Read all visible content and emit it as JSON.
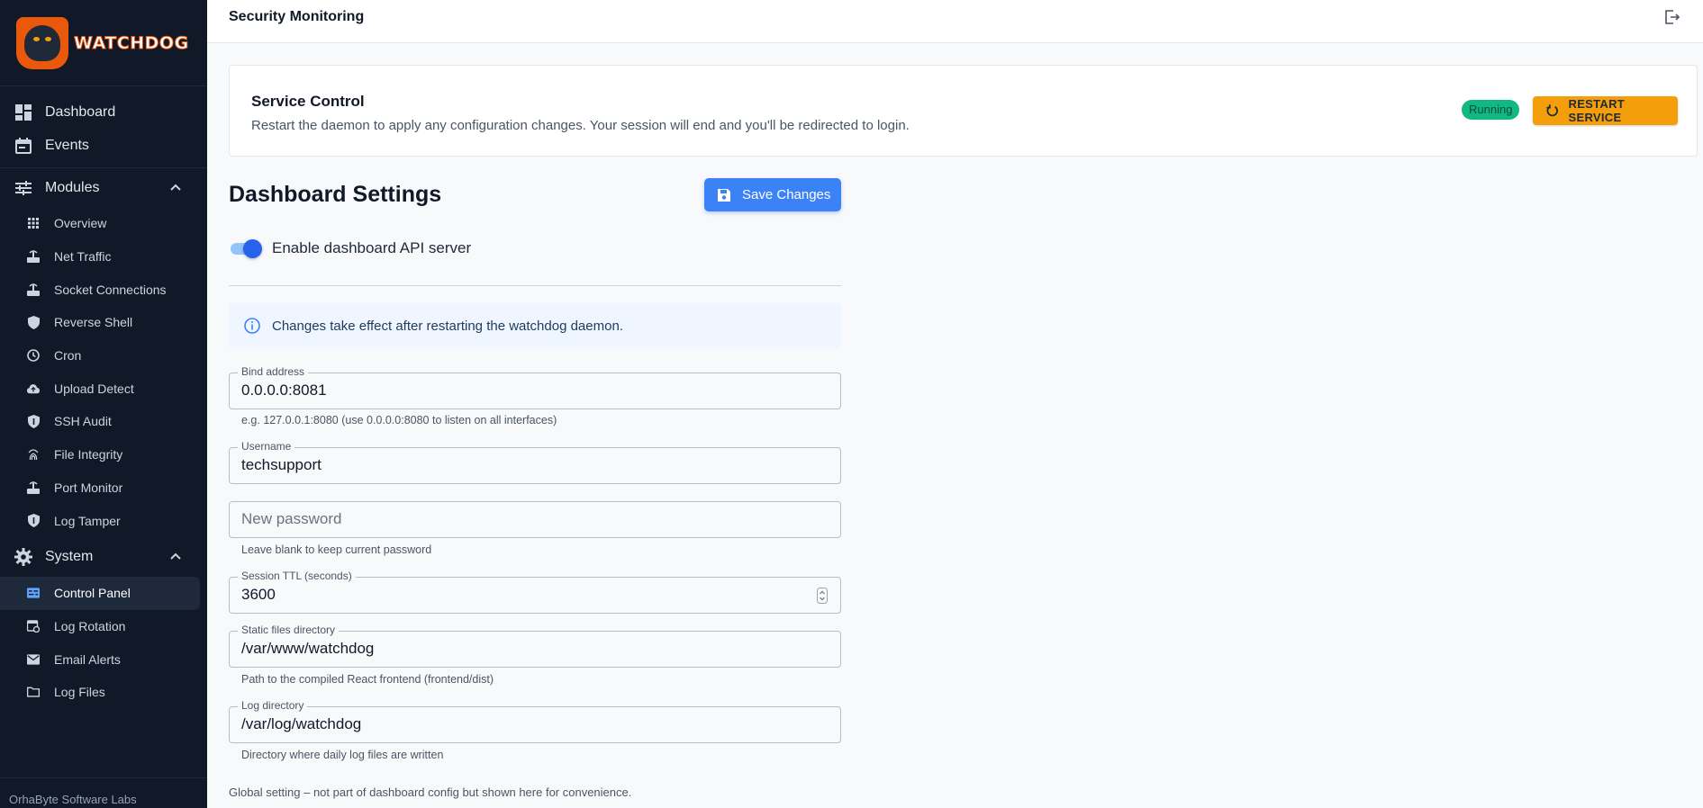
{
  "brand": {
    "logo_text": "WATCHDOG",
    "footer": "OrhaByte Software Labs"
  },
  "sidebar": {
    "top_items": [
      {
        "label": "Dashboard",
        "icon": "dashboard-icon"
      },
      {
        "label": "Events",
        "icon": "calendar-icon"
      }
    ],
    "modules": {
      "label": "Modules",
      "items": [
        {
          "label": "Overview",
          "icon": "grid-icon"
        },
        {
          "label": "Net Traffic",
          "icon": "router-icon"
        },
        {
          "label": "Socket Connections",
          "icon": "router-icon"
        },
        {
          "label": "Reverse Shell",
          "icon": "shield-icon"
        },
        {
          "label": "Cron",
          "icon": "clock-icon"
        },
        {
          "label": "Upload Detect",
          "icon": "cloud-upload-icon"
        },
        {
          "label": "SSH Audit",
          "icon": "shield-check-icon"
        },
        {
          "label": "File Integrity",
          "icon": "fingerprint-icon"
        },
        {
          "label": "Port Monitor",
          "icon": "router-icon"
        },
        {
          "label": "Log Tamper",
          "icon": "shield-check-icon"
        }
      ]
    },
    "system": {
      "label": "System",
      "items": [
        {
          "label": "Control Panel",
          "icon": "control-panel-icon",
          "active": true
        },
        {
          "label": "Log Rotation",
          "icon": "event-repeat-icon"
        },
        {
          "label": "Email Alerts",
          "icon": "mail-icon"
        },
        {
          "label": "Log Files",
          "icon": "folder-icon"
        }
      ]
    }
  },
  "header": {
    "title": "Security Monitoring"
  },
  "service_control": {
    "title": "Service Control",
    "description": "Restart the daemon to apply any configuration changes. Your session will end and you'll be redirected to login.",
    "status": "Running",
    "status_color": "#10b981",
    "restart_label": "RESTART SERVICE",
    "restart_color": "#f59e0b"
  },
  "dashboard_settings": {
    "title": "Dashboard Settings",
    "save_label": "Save Changes",
    "toggle_label": "Enable dashboard API server",
    "toggle_on": true,
    "info_text": "Changes take effect after restarting the watchdog daemon.",
    "fields": {
      "bind_address": {
        "label": "Bind address",
        "value": "0.0.0.0:8081",
        "helper": "e.g. 127.0.0.1:8080 (use 0.0.0.0:8080 to listen on all interfaces)"
      },
      "username": {
        "label": "Username",
        "value": "techsupport"
      },
      "new_password": {
        "placeholder": "New password",
        "helper": "Leave blank to keep current password"
      },
      "session_ttl": {
        "label": "Session TTL (seconds)",
        "value": "3600"
      },
      "static_dir": {
        "label": "Static files directory",
        "value": "/var/www/watchdog",
        "helper": "Path to the compiled React frontend (frontend/dist)"
      },
      "log_dir": {
        "label": "Log directory",
        "value": "/var/log/watchdog",
        "helper": "Directory where daily log files are written"
      }
    },
    "footnote": "Global setting – not part of dashboard config but shown here for convenience."
  }
}
